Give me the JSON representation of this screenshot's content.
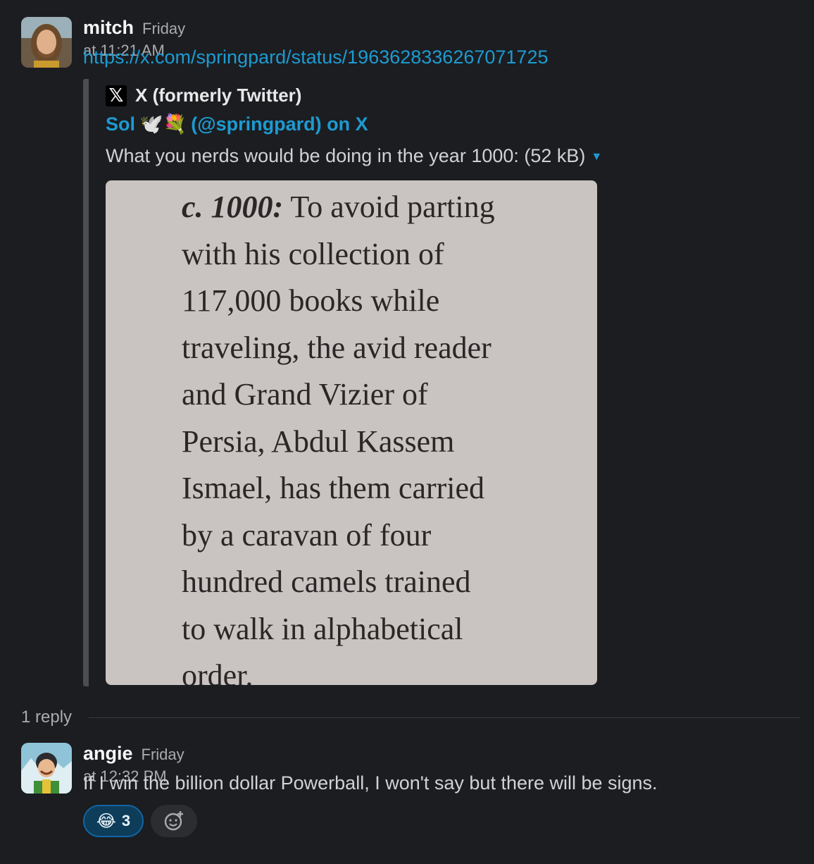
{
  "messages": [
    {
      "author": "mitch",
      "time": "Friday at 11:21 AM",
      "link": "https://x.com/springpard/status/1963628336267071725",
      "avatar_icon": "mitch-avatar",
      "unfurl": {
        "service": "X (formerly Twitter)",
        "title_name": "Sol",
        "title_emoji": "🕊️💐",
        "title_handle": "(@springpard) on X",
        "description": "What you nerds would be doing in the year 1000: (52 kB)",
        "image_lines": [
          {
            "bold": "c. 1000:",
            "text": " To avoid parting"
          },
          {
            "bold": "",
            "text": "with his collection of"
          },
          {
            "bold": "",
            "text": "117,000 books while"
          },
          {
            "bold": "",
            "text": "traveling, the avid reader"
          },
          {
            "bold": "",
            "text": "and Grand Vizier of"
          },
          {
            "bold": "",
            "text": "Persia, Abdul Kassem"
          },
          {
            "bold": "",
            "text": "Ismael, has them carried"
          },
          {
            "bold": "",
            "text": "by a caravan of four"
          },
          {
            "bold": "",
            "text": "hundred camels trained"
          },
          {
            "bold": "",
            "text": "to walk in alphabetical"
          },
          {
            "bold": "",
            "text": "order."
          }
        ]
      }
    },
    {
      "author": "angie",
      "time": "Friday at 12:32 PM",
      "text": "If I win the billion dollar Powerball, I won't say but there will be signs.",
      "avatar_icon": "angie-avatar",
      "reactions": [
        {
          "emoji": "😂",
          "count": "3",
          "icon": "laughing-tears-emoji"
        }
      ]
    }
  ],
  "thread": {
    "replies_label": "1 reply"
  },
  "colors": {
    "link": "#1d9bd1",
    "background": "#1b1d21",
    "reaction_bg": "#0e3d5a"
  }
}
